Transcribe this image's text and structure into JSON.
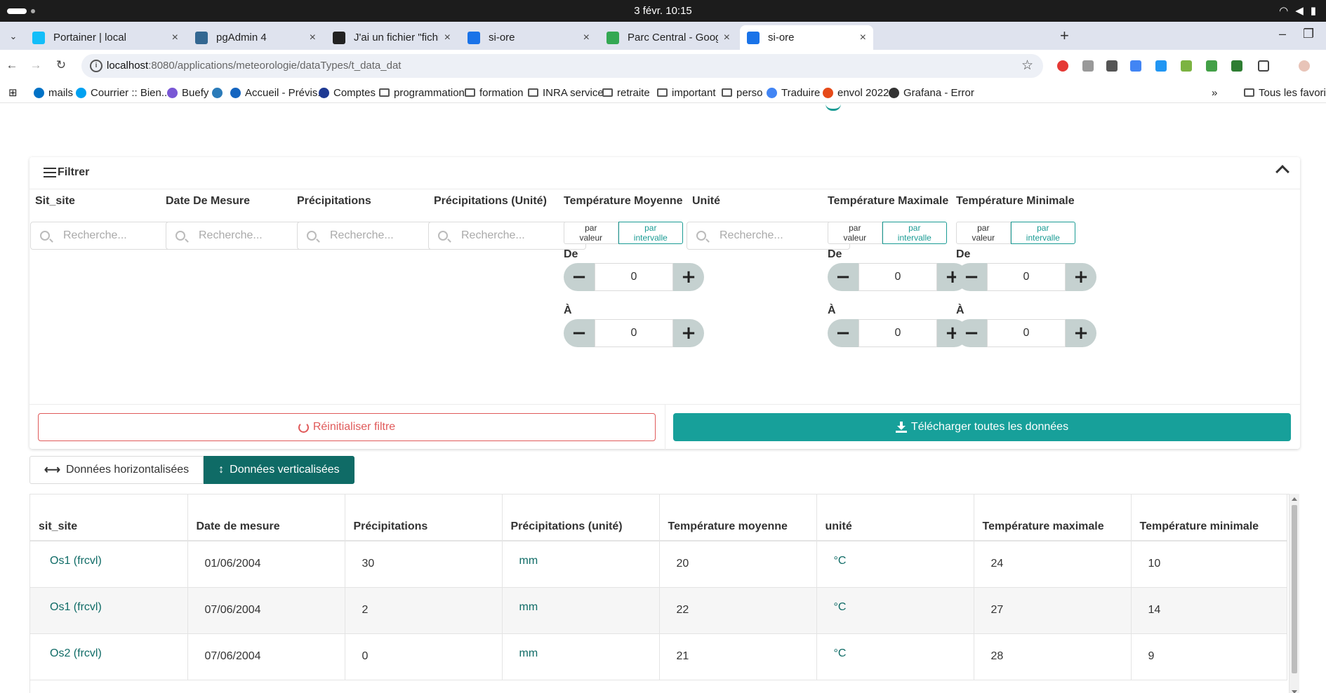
{
  "os": {
    "clock": "3 févr.  10:15"
  },
  "browser": {
    "tabs": [
      {
        "title": "Portainer | local",
        "icon": "portainer-icon",
        "color": "#13bef9"
      },
      {
        "title": "pgAdmin 4",
        "icon": "pgadmin-icon",
        "color": "#336791"
      },
      {
        "title": "J'ai un fichier \"fichiers/t_",
        "icon": "chat-icon",
        "color": "#222222"
      },
      {
        "title": "si-ore",
        "icon": "si-ore-icon",
        "color": "#1a73e8"
      },
      {
        "title": "Parc Central - Google Ma",
        "icon": "maps-pin-icon",
        "color": "#34a853"
      },
      {
        "title": "si-ore",
        "icon": "si-ore-icon",
        "color": "#1a73e8",
        "active": true
      }
    ],
    "url_host": "localhost",
    "url_path": ":8080/applications/meteorologie/dataTypes/t_data_dat",
    "bookmarks": [
      {
        "label": "mails",
        "icon": "outlook-icon"
      },
      {
        "label": "Courrier :: Bien...",
        "icon": "mail-icon"
      },
      {
        "label": "Buefy",
        "icon": "buefy-icon"
      },
      {
        "label": "",
        "icon": "ae-icon"
      },
      {
        "label": "Accueil - Prévis...",
        "icon": "meteo-icon"
      },
      {
        "label": "Comptes",
        "icon": "comptes-icon"
      },
      {
        "label": "programmation",
        "icon": "folder-icon"
      },
      {
        "label": "formation",
        "icon": "folder-icon"
      },
      {
        "label": "INRA service",
        "icon": "folder-icon"
      },
      {
        "label": "retraite",
        "icon": "folder-icon"
      },
      {
        "label": "important",
        "icon": "folder-icon"
      },
      {
        "label": "perso",
        "icon": "folder-icon"
      },
      {
        "label": "Traduire",
        "icon": "translate-icon"
      },
      {
        "label": "envol 2022",
        "icon": "envol-icon"
      },
      {
        "label": "Grafana - Error",
        "icon": "github-icon"
      }
    ],
    "bookmarks_more": "»",
    "bookmarks_all": "Tous les favoris"
  },
  "filter": {
    "title": "Filtrer",
    "columns": [
      {
        "label": "Sit_site",
        "type": "select",
        "placeholder": "Recherche..."
      },
      {
        "label": "Date De Mesure",
        "type": "search",
        "placeholder": "Recherche..."
      },
      {
        "label": "Précipitations",
        "type": "search",
        "placeholder": "Recherche..."
      },
      {
        "label": "Précipitations (Unité)",
        "type": "select",
        "placeholder": "Recherche..."
      },
      {
        "label": "Température Moyenne",
        "type": "range",
        "by_value": "par valeur",
        "by_interval": "par intervalle",
        "from_label": "De",
        "to_label": "À",
        "from": "0",
        "to": "0"
      },
      {
        "label": "Unité",
        "type": "select",
        "placeholder": "Recherche..."
      },
      {
        "label": "Température Maximale",
        "type": "range",
        "by_value": "par valeur",
        "by_interval": "par intervalle",
        "from_label": "De",
        "to_label": "À",
        "from": "0",
        "to": "0"
      },
      {
        "label": "Température Minimale",
        "type": "range",
        "by_value": "par valeur",
        "by_interval": "par intervalle",
        "from_label": "De",
        "to_label": "À",
        "from": "0",
        "to": "0"
      }
    ],
    "reset_label": "Réinitialiser filtre",
    "download_label": "Télécharger toutes les données",
    "accent_color": "#17a09a",
    "danger_color": "#e05a5a"
  },
  "view": {
    "horizontal_label": "Données horizontalisées",
    "vertical_label": "Données verticalisées",
    "selected": "vertical"
  },
  "table": {
    "headers": [
      "sit_site",
      "Date de mesure",
      "Précipitations",
      "Précipitations (unité)",
      "Température moyenne",
      "unité",
      "Température maximale",
      "Température minimale"
    ],
    "rows": [
      [
        "Os1 (frcvl)",
        "01/06/2004",
        "30",
        "mm",
        "20",
        "°C",
        "24",
        "10"
      ],
      [
        "Os1 (frcvl)",
        "07/06/2004",
        "2",
        "mm",
        "22",
        "°C",
        "27",
        "14"
      ],
      [
        "Os2 (frcvl)",
        "07/06/2004",
        "0",
        "mm",
        "21",
        "°C",
        "28",
        "9"
      ]
    ]
  }
}
